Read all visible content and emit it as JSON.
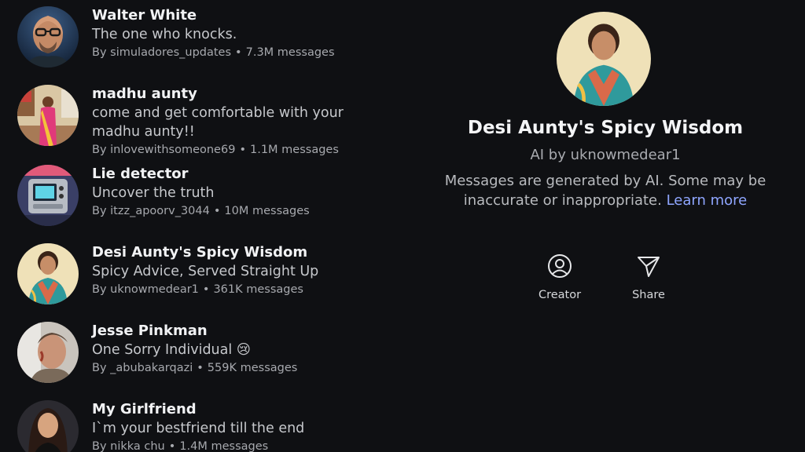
{
  "characters": [
    {
      "name": "Walter White",
      "description": "The one who knocks.",
      "author": "By simuladores_updates",
      "messages": "7.3M messages",
      "avatar_icon": "walter-white-avatar"
    },
    {
      "name": "madhu aunty",
      "description": "come and get comfortable with your madhu aunty!!",
      "author": "By inlovewithsomeone69",
      "messages": "1.1M messages",
      "avatar_icon": "madhu-aunty-avatar"
    },
    {
      "name": "Lie detector",
      "description": "Uncover the truth",
      "author": "By itzz_apoorv_3044",
      "messages": "10M messages",
      "avatar_icon": "lie-detector-avatar"
    },
    {
      "name": "Desi Aunty's Spicy Wisdom",
      "description": "Spicy Advice, Served Straight Up",
      "author": "By uknowmedear1",
      "messages": "361K messages",
      "avatar_icon": "desi-aunty-avatar"
    },
    {
      "name": "Jesse Pinkman",
      "description": "One Sorry Individual 😢",
      "author": "By _abubakarqazi",
      "messages": "559K messages",
      "avatar_icon": "jesse-pinkman-avatar"
    },
    {
      "name": "My Girlfriend",
      "description": "I`m your bestfriend till the end",
      "author": "By nikka chu",
      "messages": "1.4M messages",
      "avatar_icon": "girlfriend-avatar"
    }
  ],
  "detail": {
    "title": "Desi Aunty's Spicy Wisdom",
    "by_line": "AI by uknowmedear1",
    "disclaimer": "Messages are generated by AI. Some may be inaccurate or inappropriate.",
    "learn_more": "Learn more",
    "actions": {
      "creator_label": "Creator",
      "share_label": "Share"
    }
  },
  "colors": {
    "background": "#0f1013",
    "link": "#8fa6ff"
  }
}
